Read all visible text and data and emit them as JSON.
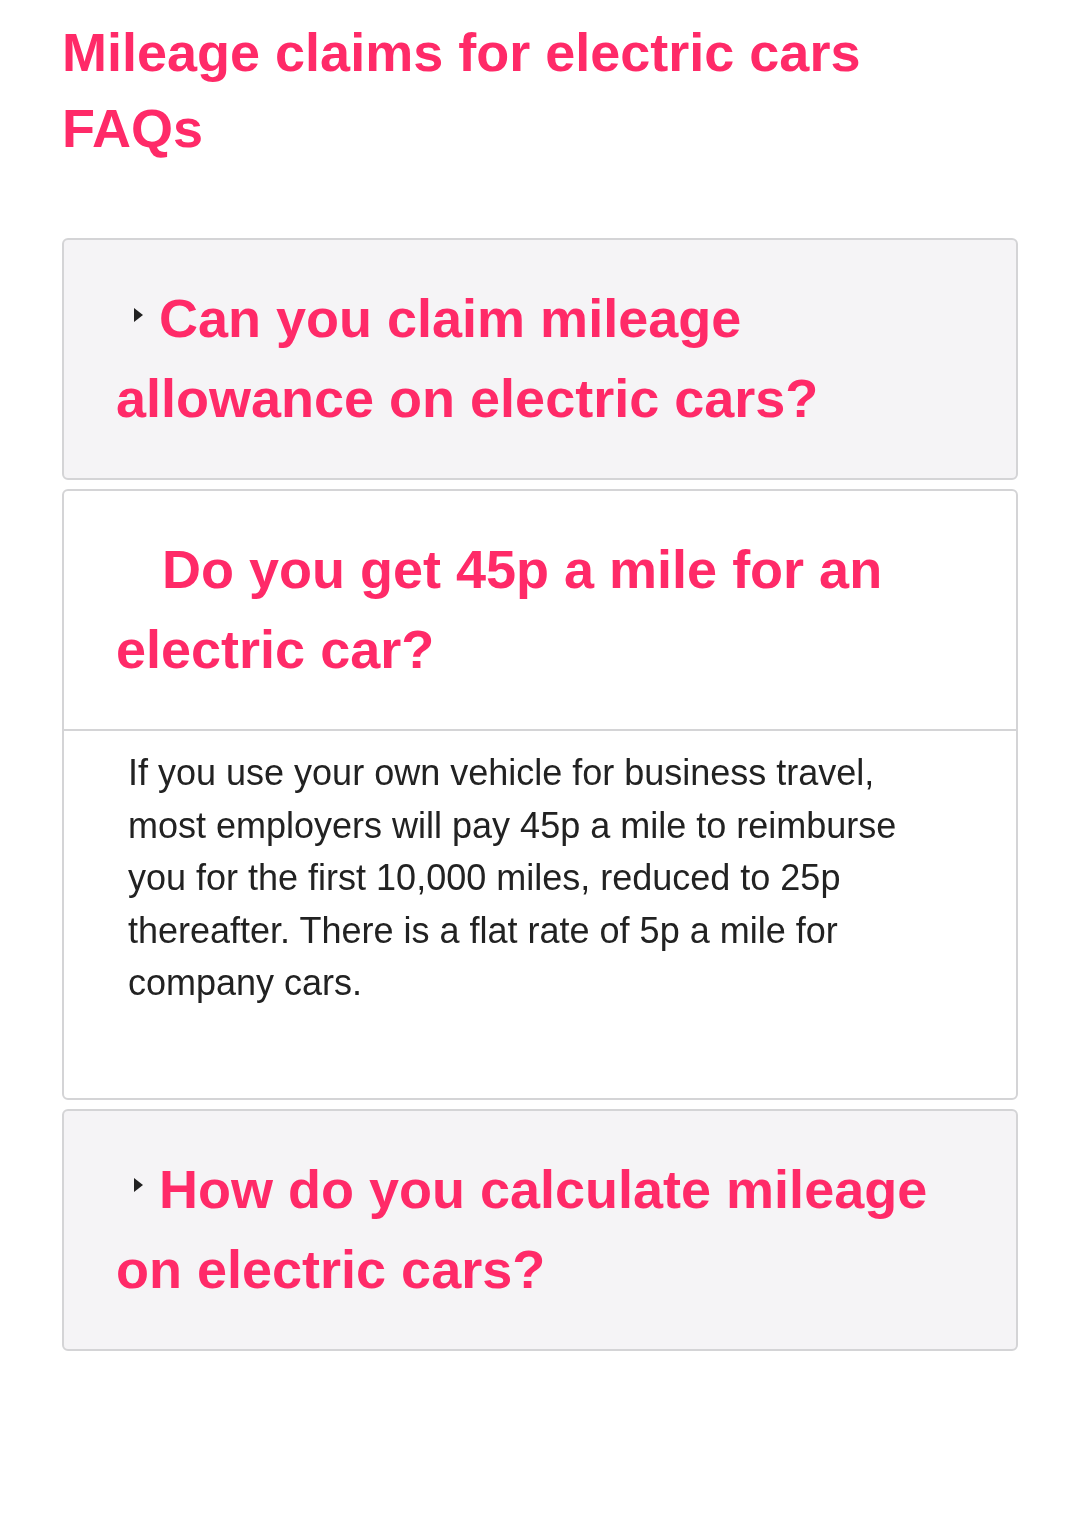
{
  "heading": "Mileage claims for electric cars FAQs",
  "faqs": [
    {
      "question": "Can you claim mileage allowance on electric cars?",
      "expanded": false
    },
    {
      "question": "Do you get 45p a mile for an electric car?",
      "expanded": true,
      "answer": "If you use your own vehicle for business travel, most employers will pay 45p a mile to reimburse you for the first 10,000 miles, reduced to 25p thereafter. There is a flat rate of 5p a mile for company cars."
    },
    {
      "question": "How do you calculate mileage on electric cars?",
      "expanded": false
    }
  ]
}
